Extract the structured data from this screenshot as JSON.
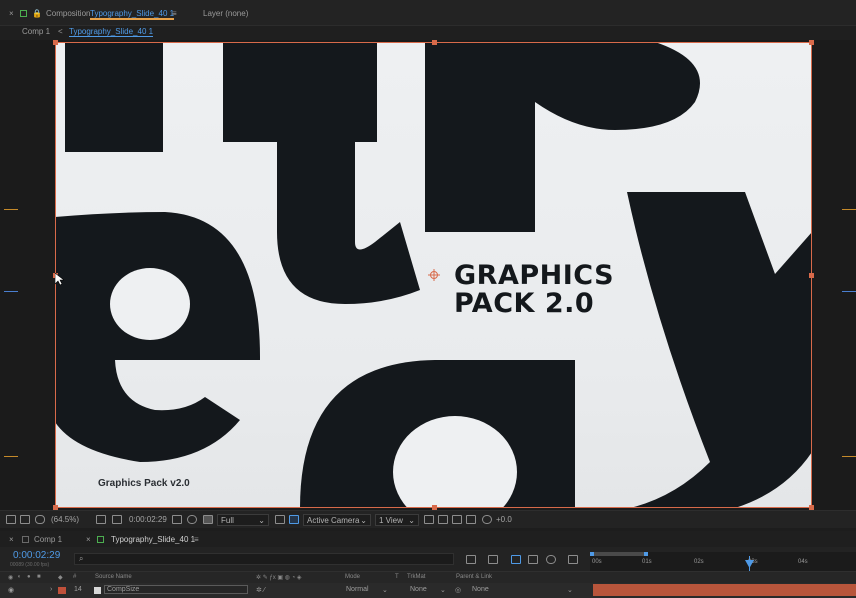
{
  "panel": {
    "close": "×",
    "composition_label": "Composition",
    "composition_name": "Typography_Slide_40 1",
    "menu": "≡",
    "layer_label": "Layer (none)"
  },
  "comp_tabs": {
    "first": "Comp 1",
    "arrow": "<",
    "second": "Typography_Slide_40 1"
  },
  "canvas": {
    "headline_line1": "GRAPHICS",
    "headline_line2": "PACK 2.0",
    "caption": "Graphics Pack v2.0"
  },
  "viewer_toolbar": {
    "zoom": "(64.5%)",
    "timecode": "0:00:02:29",
    "resolution": "Full",
    "camera": "Active Camera",
    "views": "1 View",
    "exposure": "+0.0"
  },
  "timeline": {
    "tab_comp1": "Comp 1",
    "tab_active": "Typography_Slide_40 1",
    "tab_menu": "≡",
    "current_time": "0:00:02:29",
    "frame_info": "00089 (30.00 fps)",
    "search_placeholder": "",
    "columns": {
      "hash": "#",
      "source_name": "Source Name",
      "mode": "Mode",
      "t": "T",
      "trkmat": "TrkMat",
      "parent": "Parent & Link"
    },
    "ruler_ticks": [
      "00s",
      "01s",
      "02s",
      "03s",
      "04s"
    ],
    "row": {
      "number": "14",
      "name": "CompSize",
      "mode": "Normal",
      "trkmat": "None",
      "parent": "None"
    }
  },
  "colors": {
    "accent_blue": "#4f9ae6",
    "layer_bar": "#b8553b",
    "canvas_border": "#d86a4a"
  }
}
